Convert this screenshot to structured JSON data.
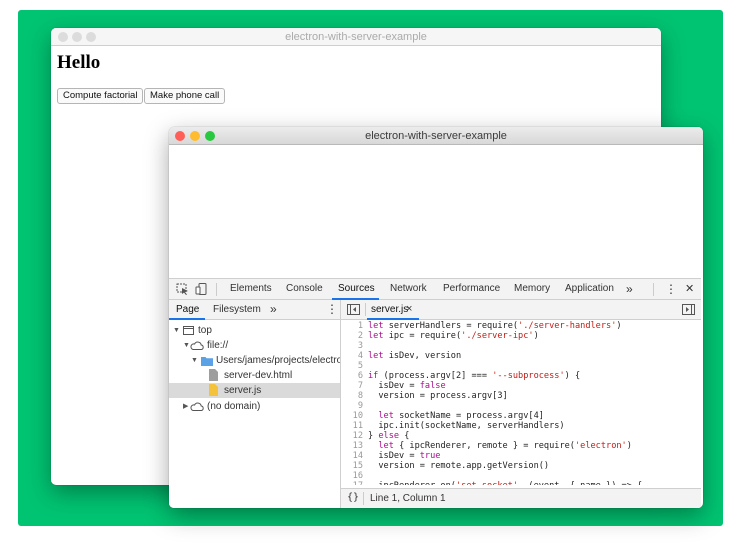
{
  "colors": {
    "background": "#00c472",
    "traffic_red": "#ff5f57",
    "traffic_yellow": "#febc2e",
    "traffic_green": "#28c840",
    "traffic_inactive": "#dcdcdc",
    "accent": "#1a73e8"
  },
  "back_window": {
    "title": "electron-with-server-example",
    "heading": "Hello",
    "buttons": [
      "Compute factorial",
      "Make phone call"
    ]
  },
  "front_window": {
    "title": "electron-with-server-example"
  },
  "devtools": {
    "tabs": [
      "Elements",
      "Console",
      "Sources",
      "Network",
      "Performance",
      "Memory",
      "Application"
    ],
    "active_tab": "Sources",
    "more_tabs": "»",
    "menu_icon": "⋮",
    "close_icon": "✕",
    "sidebar": {
      "tabs": [
        "Page",
        "Filesystem"
      ],
      "active_tab": "Page",
      "more": "»",
      "tree": [
        {
          "label": "top",
          "icon": "frame-icon"
        },
        {
          "label": "file://",
          "icon": "cloud-icon"
        },
        {
          "label": "Users/james/projects/electron-",
          "icon": "folder-icon"
        },
        {
          "label": "server-dev.html",
          "icon": "file-icon"
        },
        {
          "label": "server.js",
          "icon": "js-file-icon",
          "selected": true
        },
        {
          "label": "(no domain)",
          "icon": "cloud-icon"
        }
      ]
    },
    "editor": {
      "open_file": "server.js",
      "close": "×",
      "status": "Line 1, Column 1",
      "format_icon": "{}",
      "lines": [
        {
          "n": "1",
          "text": "let serverHandlers = require('./server-handlers')"
        },
        {
          "n": "2",
          "text": "let ipc = require('./server-ipc')"
        },
        {
          "n": "3",
          "text": ""
        },
        {
          "n": "4",
          "text": "let isDev, version"
        },
        {
          "n": "5",
          "text": ""
        },
        {
          "n": "6",
          "text": "if (process.argv[2] === '--subprocess') {"
        },
        {
          "n": "7",
          "text": "  isDev = false"
        },
        {
          "n": "8",
          "text": "  version = process.argv[3]"
        },
        {
          "n": "9",
          "text": ""
        },
        {
          "n": "10",
          "text": "  let socketName = process.argv[4]"
        },
        {
          "n": "11",
          "text": "  ipc.init(socketName, serverHandlers)"
        },
        {
          "n": "12",
          "text": "} else {"
        },
        {
          "n": "13",
          "text": "  let { ipcRenderer, remote } = require('electron')"
        },
        {
          "n": "14",
          "text": "  isDev = true"
        },
        {
          "n": "15",
          "text": "  version = remote.app.getVersion()"
        },
        {
          "n": "16",
          "text": ""
        },
        {
          "n": "17",
          "text": "  ipcRenderer.on('set-socket', (event, { name }) => {"
        }
      ]
    }
  }
}
